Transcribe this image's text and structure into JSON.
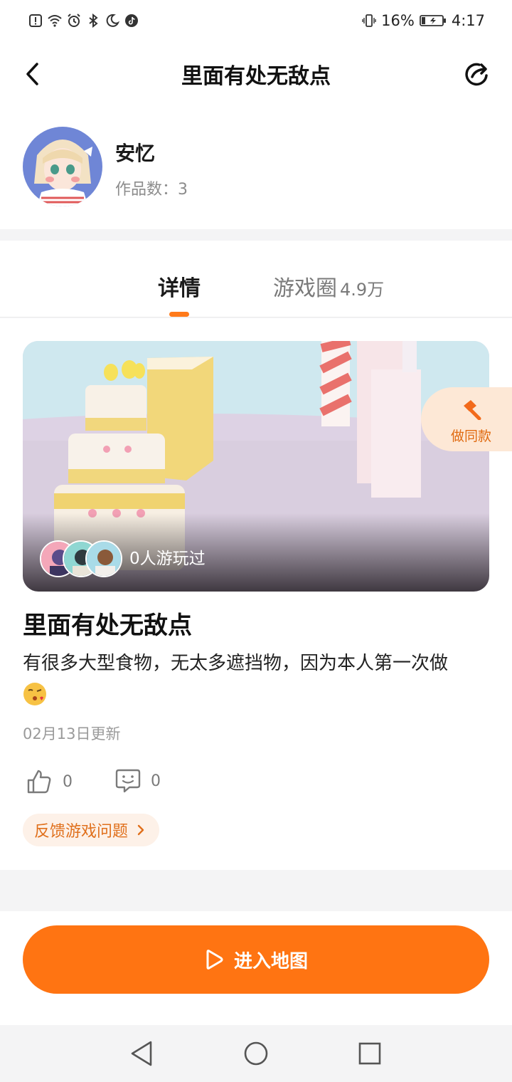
{
  "status": {
    "battery": "16%",
    "time": "4:17"
  },
  "header": {
    "title": "里面有处无敌点"
  },
  "author": {
    "name": "安忆",
    "works": "作品数：3"
  },
  "tabs": {
    "detail": "详情",
    "circle": "游戏圈",
    "circle_count": "4.9万"
  },
  "game": {
    "played": "0人游玩过",
    "make_same": "做同款",
    "title": "里面有处无敌点",
    "description": "有很多大型食物，无太多遮挡物，因为本人第一次做",
    "updated": "02月13日更新",
    "likes": "0",
    "comments": "0",
    "feedback": "反馈游戏问题"
  },
  "action": {
    "enter": "进入地图"
  },
  "colors": {
    "accent": "#ff7412",
    "accent_light": "#fde8d6"
  }
}
